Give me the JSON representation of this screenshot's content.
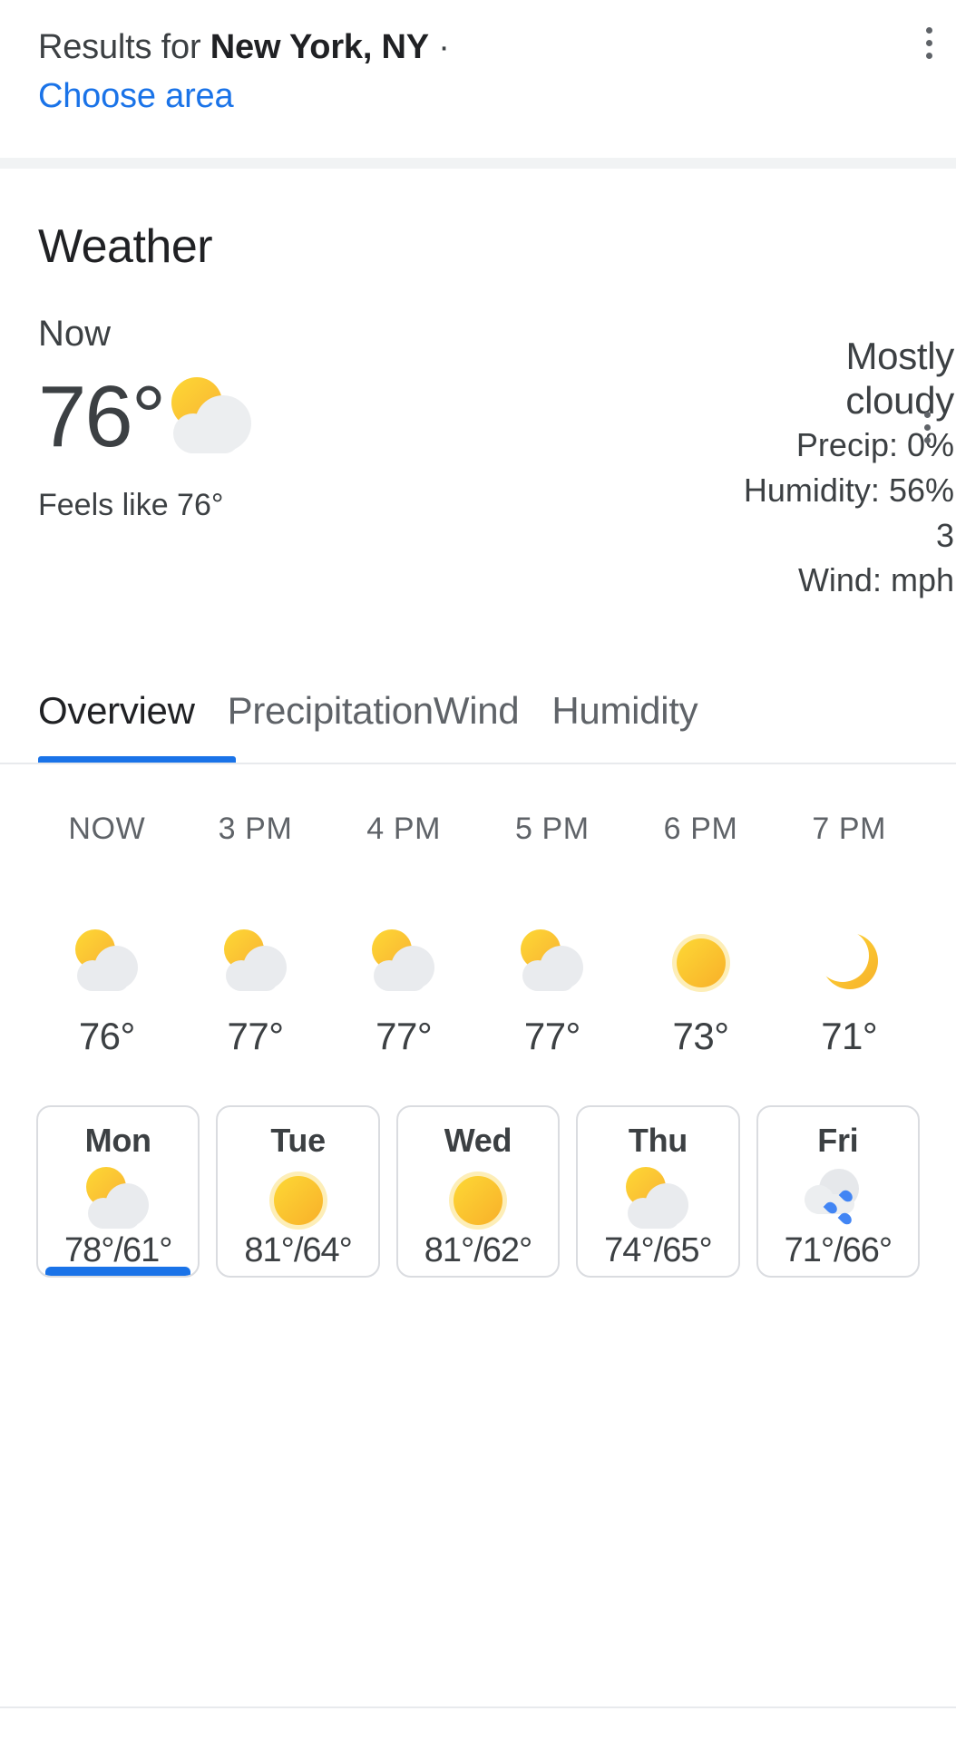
{
  "results_header": {
    "prefix": "Results for ",
    "location": "New York, NY",
    "separator": " ·",
    "choose_area": "Choose area",
    "menu_icon": "more-vertical-icon"
  },
  "weather": {
    "title": "Weather",
    "menu_icon": "more-vertical-icon",
    "now_label": "Now",
    "temperature": "76°",
    "feels_like": "Feels like 76°",
    "now_icon": "partly-cloudy-icon",
    "condition_line1": "Mostly",
    "condition_line2": "cloudy",
    "precip": "Precip: 0%",
    "humidity": "Humidity: 56%",
    "wind_value": "3",
    "wind": "Wind:  mph"
  },
  "tabs": [
    {
      "label": "Overview",
      "active": true
    },
    {
      "label": "Precipitation",
      "active": false
    },
    {
      "label": "Wind",
      "active": false
    },
    {
      "label": "Humidity",
      "active": false
    }
  ],
  "hourly": [
    {
      "time": "NOW",
      "icon": "partly-cloudy-icon",
      "temp": "76°"
    },
    {
      "time": "3 PM",
      "icon": "partly-cloudy-icon",
      "temp": "77°"
    },
    {
      "time": "4 PM",
      "icon": "partly-cloudy-icon",
      "temp": "77°"
    },
    {
      "time": "5 PM",
      "icon": "partly-cloudy-icon",
      "temp": "77°"
    },
    {
      "time": "6 PM",
      "icon": "sun-icon",
      "temp": "73°"
    },
    {
      "time": "7 PM",
      "icon": "moon-icon",
      "temp": "71°"
    }
  ],
  "daily": [
    {
      "day": "Mon",
      "icon": "partly-cloudy-icon",
      "temps": "78°/61°",
      "active": true
    },
    {
      "day": "Tue",
      "icon": "sun-icon",
      "temps": "81°/64°",
      "active": false
    },
    {
      "day": "Wed",
      "icon": "sun-icon",
      "temps": "81°/62°",
      "active": false
    },
    {
      "day": "Thu",
      "icon": "partly-cloudy-icon",
      "temps": "74°/65°",
      "active": false
    },
    {
      "day": "Fri",
      "icon": "rain-icon",
      "temps": "71°/66°",
      "active": false
    }
  ],
  "colors": {
    "accent": "#1a73e8",
    "link": "#1a73e8",
    "text_primary": "#202124",
    "text_secondary": "#3c4043",
    "text_muted": "#5f6368",
    "sun": "#f9b233",
    "rain_drop": "#4285f4"
  }
}
